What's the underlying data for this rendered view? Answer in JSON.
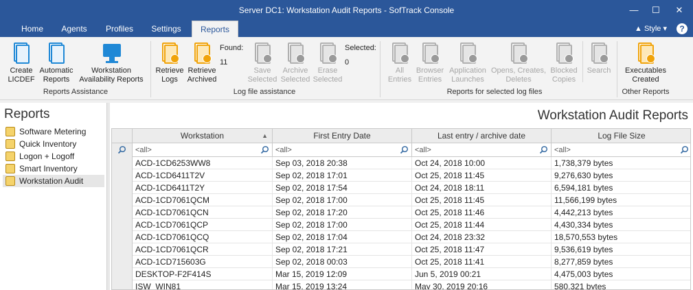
{
  "window": {
    "title": "Server DC1: Workstation Audit Reports - SofTrack Console"
  },
  "tabs": [
    {
      "label": "Home"
    },
    {
      "label": "Agents"
    },
    {
      "label": "Profiles"
    },
    {
      "label": "Settings"
    },
    {
      "label": "Reports",
      "active": true
    }
  ],
  "style_label": "Style",
  "help_label": "?",
  "ribbon": {
    "groups": {
      "reports_assistance": "Reports Assistance",
      "log_file_assistance": "Log file assistance",
      "reports_selected": "Reports for selected log files",
      "other_reports": "Other Reports"
    },
    "buttons": {
      "create_licdef": "Create LICDEF",
      "automatic_reports": "Automatic Reports",
      "workstation_availability": "Workstation Availability Reports",
      "retrieve_logs": "Retrieve Logs",
      "retrieve_archived": "Retrieve Archived",
      "save_selected": "Save Selected",
      "archive_selected": "Archive Selected",
      "erase_selected": "Erase Selected",
      "all_entries": "All Entries",
      "browser_entries": "Browser Entries",
      "application_launches": "Application Launches",
      "opens_creates_deletes": "Opens, Creates, Deletes",
      "blocked_copies": "Blocked Copies",
      "search": "Search",
      "executables_created": "Executables Created"
    },
    "found_label": "Found:",
    "found_value": "11",
    "selected_label": "Selected:",
    "selected_value": "0"
  },
  "left": {
    "title": "Reports",
    "items": [
      {
        "label": "Software Metering"
      },
      {
        "label": "Quick Inventory"
      },
      {
        "label": "Logon + Logoff"
      },
      {
        "label": "Smart Inventory"
      },
      {
        "label": "Workstation Audit",
        "selected": true
      }
    ]
  },
  "main": {
    "title": "Workstation Audit Reports",
    "columns": [
      "Workstation",
      "First Entry Date",
      "Last entry / archive date",
      "Log File Size"
    ],
    "filter_placeholder": "<all>",
    "rows": [
      [
        "ACD-1CD6253WW8",
        "Sep 03, 2018 20:38",
        "Oct 24, 2018 10:00",
        "1,738,379 bytes"
      ],
      [
        "ACD-1CD6411T2V",
        "Sep 02, 2018 17:01",
        "Oct 25, 2018 11:45",
        "9,276,630 bytes"
      ],
      [
        "ACD-1CD6411T2Y",
        "Sep 02, 2018 17:54",
        "Oct 24, 2018 18:11",
        "6,594,181 bytes"
      ],
      [
        "ACD-1CD7061QCM",
        "Sep 02, 2018 17:00",
        "Oct 25, 2018 11:45",
        "11,566,199 bytes"
      ],
      [
        "ACD-1CD7061QCN",
        "Sep 02, 2018 17:20",
        "Oct 25, 2018 11:46",
        "4,442,213 bytes"
      ],
      [
        "ACD-1CD7061QCP",
        "Sep 02, 2018 17:00",
        "Oct 25, 2018 11:44",
        "4,430,334 bytes"
      ],
      [
        "ACD-1CD7061QCQ",
        "Sep 02, 2018 17:04",
        "Oct 24, 2018 23:32",
        "18,570,553 bytes"
      ],
      [
        "ACD-1CD7061QCR",
        "Sep 02, 2018 17:21",
        "Oct 25, 2018 11:47",
        "9,536,619 bytes"
      ],
      [
        "ACD-1CD715603G",
        "Sep 02, 2018 00:03",
        "Oct 25, 2018 11:41",
        "8,277,859 bytes"
      ],
      [
        "DESKTOP-F2F414S",
        "Mar 15, 2019 12:09",
        "Jun 5, 2019 00:21",
        "4,475,003 bytes"
      ],
      [
        "ISW_WIN81",
        "Mar 15, 2019 13:24",
        "May 30, 2019 20:16",
        "580,321 bytes"
      ]
    ]
  }
}
